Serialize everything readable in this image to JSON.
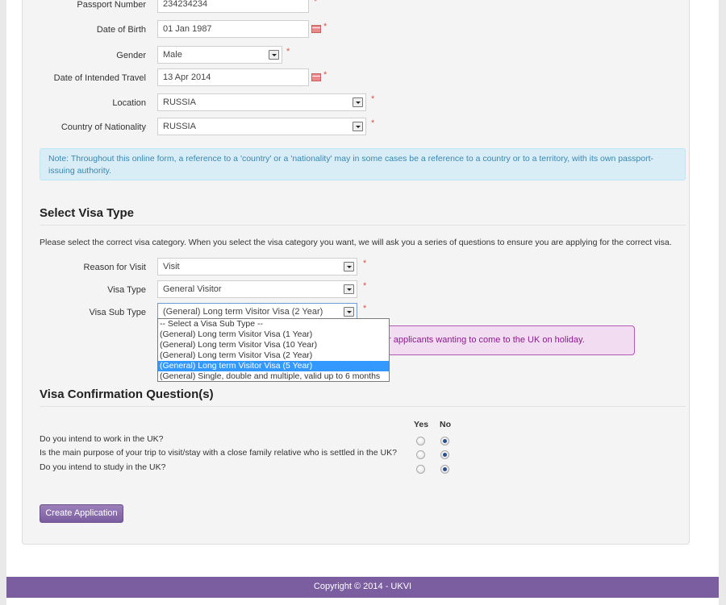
{
  "form": {
    "passport_number": {
      "label": "Passport Number",
      "value": "234234234"
    },
    "date_of_birth": {
      "label": "Date of Birth",
      "value": "01 Jan 1987"
    },
    "gender": {
      "label": "Gender",
      "value": "Male"
    },
    "date_of_travel": {
      "label": "Date of Intended Travel",
      "value": "13 Apr 2014"
    },
    "location": {
      "label": "Location",
      "value": "RUSSIA"
    },
    "nationality": {
      "label": "Country of Nationality",
      "value": "RUSSIA"
    },
    "required_mark": "*"
  },
  "note": "Note: Throughout this online form, a reference to a 'country' or a 'nationality' may in some cases be a reference to a country or to a territory, with its own passport-issuing authority.",
  "visa_type": {
    "heading": "Select Visa Type",
    "intro": "Please select the correct visa category. When you select the visa category you want, we will ask you a series of questions to ensure you are applying for the correct visa.",
    "reason": {
      "label": "Reason for Visit",
      "value": "Visit"
    },
    "type": {
      "label": "Visa Type",
      "value": "General Visitor"
    },
    "subtype": {
      "label": "Visa Sub Type",
      "value": "(General) Long term Visitor Visa (2 Year)",
      "options": [
        "-- Select a Visa Sub Type --",
        "(General) Long term Visitor Visa (1 Year)",
        "(General) Long term Visitor Visa (10 Year)",
        "(General) Long term Visitor Visa (2 Year)",
        "(General) Long term Visitor Visa (5 Year)",
        "(General) Single, double and multiple, valid up to 6 months"
      ],
      "highlighted_index": 4
    },
    "info_message": "r applicants wanting to come to the UK on holiday."
  },
  "confirmation": {
    "heading": "Visa Confirmation Question(s)",
    "yes_label": "Yes",
    "no_label": "No",
    "questions": [
      {
        "text": "Do you intend to work in the UK?",
        "answer": "No"
      },
      {
        "text": "Is the main purpose of your trip to visit/stay with a close family relative who is settled in the UK?",
        "answer": "No"
      },
      {
        "text": "Do you intend to study in the UK?",
        "answer": "No"
      }
    ]
  },
  "create_button": "Create Application",
  "footer": "Copyright © 2014 - UKVI",
  "colors": {
    "accent": "#7b5ea0",
    "info_bg": "#d9edf7",
    "highlight": "#3399ff",
    "required": "#d9534f"
  }
}
